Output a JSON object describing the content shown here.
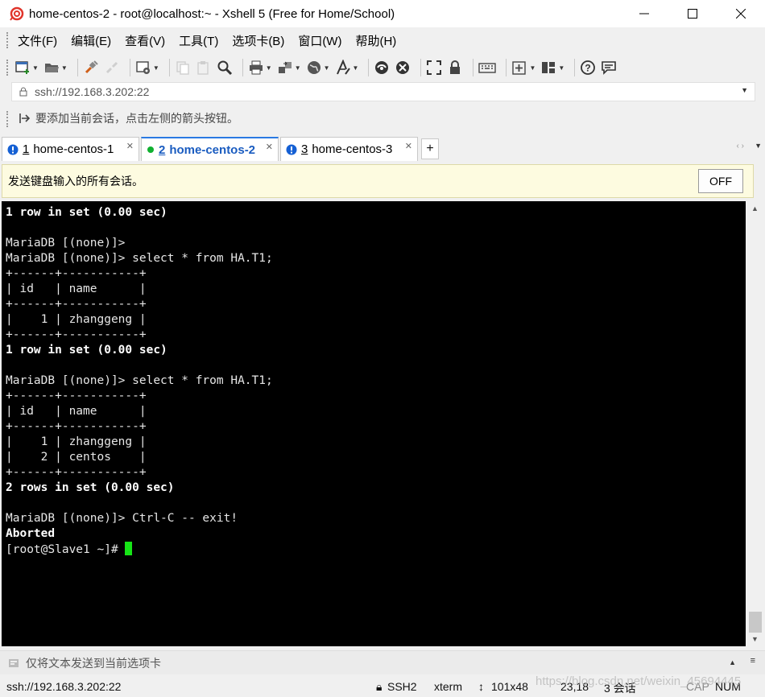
{
  "window": {
    "title": "home-centos-2 - root@localhost:~ - Xshell 5 (Free for Home/School)"
  },
  "menu": [
    "文件(F)",
    "编辑(E)",
    "查看(V)",
    "工具(T)",
    "选项卡(B)",
    "窗口(W)",
    "帮助(H)"
  ],
  "address": {
    "value": "ssh://192.168.3.202:22"
  },
  "hint": {
    "text": "要添加当前会话，点击左侧的箭头按钮。"
  },
  "tabs": [
    {
      "number": "1",
      "name": "home-centos-1",
      "status_color": "#1560d4"
    },
    {
      "number": "2",
      "name": "home-centos-2",
      "status_color": "#10b030"
    },
    {
      "number": "3",
      "name": "home-centos-3",
      "status_color": "#1560d4"
    }
  ],
  "compose": {
    "text": "发送键盘输入的所有会话。",
    "button": "OFF"
  },
  "terminal": {
    "lines": [
      {
        "text": "1 row in set (0.00 sec)",
        "bold": true
      },
      {
        "text": "",
        "bold": false
      },
      {
        "text": "MariaDB [(none)]>",
        "bold": false
      },
      {
        "text": "MariaDB [(none)]> select * from HA.T1;",
        "bold": false
      },
      {
        "text": "+------+-----------+",
        "bold": false
      },
      {
        "text": "| id   | name      |",
        "bold": false
      },
      {
        "text": "+------+-----------+",
        "bold": false
      },
      {
        "text": "|    1 | zhanggeng |",
        "bold": false
      },
      {
        "text": "+------+-----------+",
        "bold": false
      },
      {
        "text": "1 row in set (0.00 sec)",
        "bold": true
      },
      {
        "text": "",
        "bold": false
      },
      {
        "text": "MariaDB [(none)]> select * from HA.T1;",
        "bold": false
      },
      {
        "text": "+------+-----------+",
        "bold": false
      },
      {
        "text": "| id   | name      |",
        "bold": false
      },
      {
        "text": "+------+-----------+",
        "bold": false
      },
      {
        "text": "|    1 | zhanggeng |",
        "bold": false
      },
      {
        "text": "|    2 | centos    |",
        "bold": false
      },
      {
        "text": "+------+-----------+",
        "bold": false
      },
      {
        "text": "2 rows in set (0.00 sec)",
        "bold": true
      },
      {
        "text": "",
        "bold": false
      },
      {
        "text": "MariaDB [(none)]> Ctrl-C -- exit!",
        "bold": false
      },
      {
        "text": "Aborted",
        "bold": true
      }
    ],
    "prompt": "[root@Slave1 ~]# ",
    "cursor_color": "#16e416"
  },
  "sendbar": {
    "placeholder": "仅将文本发送到当前选项卡"
  },
  "status": {
    "connection": "ssh://192.168.3.202:22",
    "protocol": "SSH2",
    "term": "xterm",
    "size": "101x48",
    "position": "23,18",
    "sessions": "3 会话",
    "cap": "CAP",
    "num": "NUM"
  },
  "watermark": "https://blog.csdn.net/weixin_45694445"
}
